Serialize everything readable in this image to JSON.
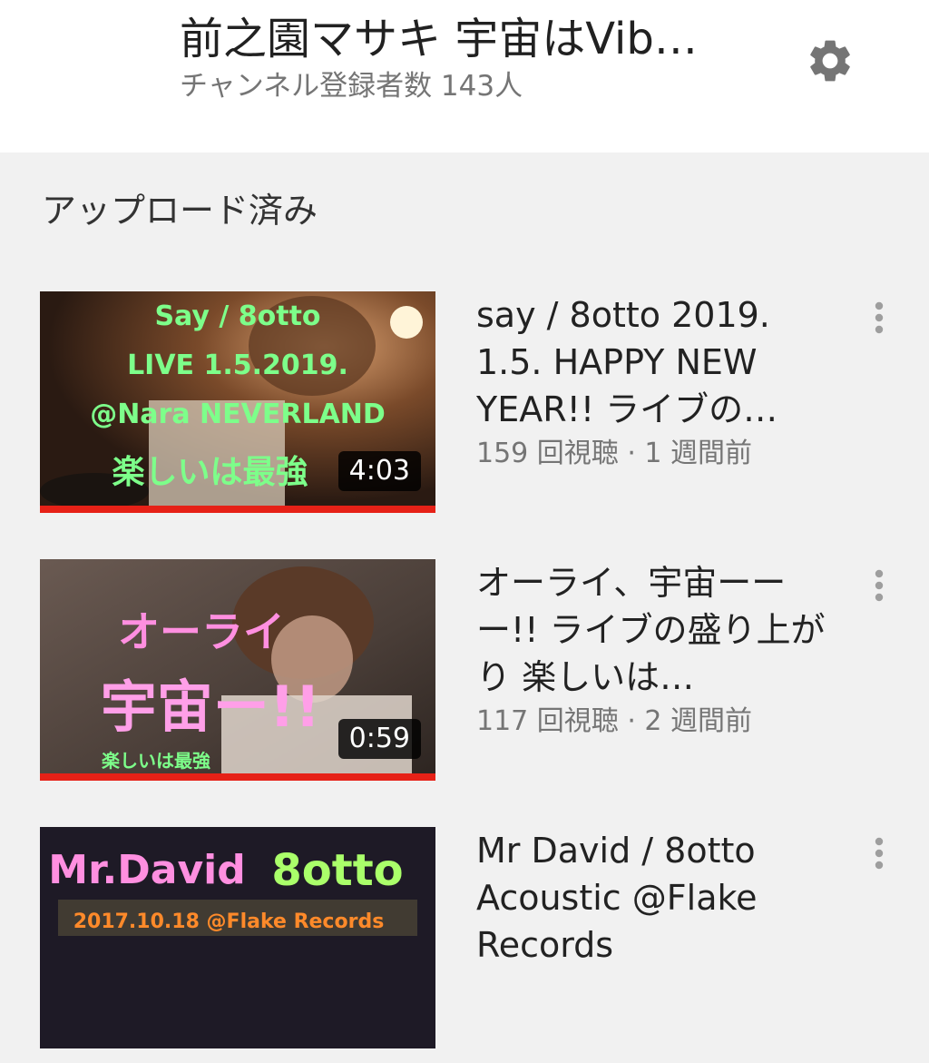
{
  "header": {
    "channel_name": "前之園マサキ 宇宙はVib…",
    "subscribers": "チャンネル登録者数 143人",
    "settings_icon": "gear-icon"
  },
  "section": {
    "title": "アップロード済み"
  },
  "colors": {
    "progress": "#e62117",
    "accent_green": "#7dff8a",
    "accent_pink": "#ff8fe0"
  },
  "videos": [
    {
      "title": "say /  8otto   2019. 1.5.  HAPPY NEW YEAR!!  ライブの…",
      "meta": "159 回視聴 · 1 週間前",
      "duration": "4:03",
      "watched_fraction": 1.0,
      "thumb_lines": [
        "Say / 8otto",
        "LIVE 1.5.2019.",
        "@Nara NEVERLAND",
        "楽しいは最強"
      ]
    },
    {
      "title": "オーライ、宇宙ーーー!!  ライブの盛り上がり 楽しいは…",
      "meta": "117 回視聴 · 2 週間前",
      "duration": "0:59",
      "watched_fraction": 1.0,
      "thumb_lines": [
        "オーライ",
        "宇宙ー!!",
        "楽しいは最強"
      ]
    },
    {
      "title": "Mr David / 8otto Acoustic @Flake Records",
      "thumb_lines": [
        "Mr.David",
        "8otto",
        "2017.10.18 @Flake Records"
      ]
    }
  ]
}
